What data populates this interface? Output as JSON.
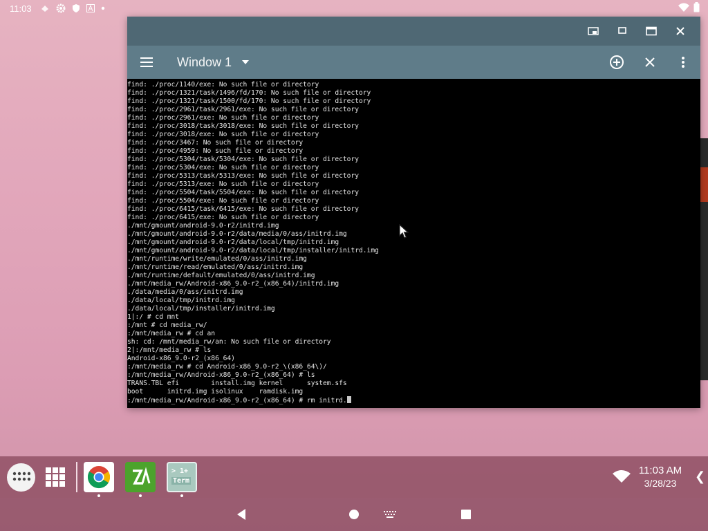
{
  "status_bar": {
    "time": "11:03",
    "icons": [
      "cloud-icon",
      "gear-icon",
      "shield-icon",
      "app-a-icon",
      "dot-icon"
    ],
    "right_icons": [
      "wifi-icon",
      "battery-icon"
    ]
  },
  "window": {
    "title_controls": [
      "picture-in-picture-icon",
      "restore-icon",
      "maximize-icon",
      "close-icon"
    ],
    "toolbar": {
      "menu_icon": "hamburger-menu-icon",
      "tab_label": "Window 1",
      "dropdown_icon": "dropdown-arrow-icon",
      "actions": [
        "add-window-icon",
        "close-window-icon",
        "more-options-icon"
      ]
    },
    "terminal": {
      "lines": [
        "find: ./proc/1140/exe: No such file or directory",
        "find: ./proc/1321/task/1496/fd/170: No such file or directory",
        "find: ./proc/1321/task/1500/fd/170: No such file or directory",
        "find: ./proc/2961/task/2961/exe: No such file or directory",
        "find: ./proc/2961/exe: No such file or directory",
        "find: ./proc/3018/task/3018/exe: No such file or directory",
        "find: ./proc/3018/exe: No such file or directory",
        "find: ./proc/3467: No such file or directory",
        "find: ./proc/4959: No such file or directory",
        "find: ./proc/5304/task/5304/exe: No such file or directory",
        "find: ./proc/5304/exe: No such file or directory",
        "find: ./proc/5313/task/5313/exe: No such file or directory",
        "find: ./proc/5313/exe: No such file or directory",
        "find: ./proc/5504/task/5504/exe: No such file or directory",
        "find: ./proc/5504/exe: No such file or directory",
        "find: ./proc/6415/task/6415/exe: No such file or directory",
        "find: ./proc/6415/exe: No such file or directory",
        "./mnt/gmount/android-9.0-r2/initrd.img",
        "./mnt/gmount/android-9.0-r2/data/media/0/ass/initrd.img",
        "./mnt/gmount/android-9.0-r2/data/local/tmp/initrd.img",
        "./mnt/gmount/android-9.0-r2/data/local/tmp/installer/initrd.img",
        "./mnt/runtime/write/emulated/0/ass/initrd.img",
        "./mnt/runtime/read/emulated/0/ass/initrd.img",
        "./mnt/runtime/default/emulated/0/ass/initrd.img",
        "./mnt/media_rw/Android-x86_9.0-r2_(x86_64)/initrd.img",
        "./data/media/0/ass/initrd.img",
        "./data/local/tmp/initrd.img",
        "./data/local/tmp/installer/initrd.img",
        "1|:/ # cd mnt",
        ":/mnt # cd media_rw/",
        ":/mnt/media_rw # cd an",
        "sh: cd: /mnt/media_rw/an: No such file or directory",
        "2|:/mnt/media_rw # ls",
        "Android-x86_9.0-r2_(x86_64)",
        ":/mnt/media_rw # cd Android-x86_9.0-r2_\\(x86_64\\)/",
        ":/mnt/media_rw/Android-x86_9.0-r2_(x86_64) # ls",
        "TRANS.TBL efi        install.img kernel      system.sfs",
        "boot      initrd.img isolinux    ramdisk.img"
      ],
      "current_prompt": ":/mnt/media_rw/Android-x86_9.0-r2_(x86_64) # rm initrd."
    }
  },
  "taskbar": {
    "all_apps_icon": "all-apps-icon",
    "grid_icon": "app-grid-icon",
    "apps": [
      {
        "name": "chrome-icon",
        "running": true
      },
      {
        "name": "zarchiver-icon",
        "running": true
      },
      {
        "name": "terminal-emulator-icon",
        "running": true
      }
    ],
    "terminal_app_label_top": "> 1+",
    "terminal_app_label_bottom": "Term",
    "tray": {
      "time": "11:03 AM",
      "date": "3/28/23",
      "chevron": "❮"
    }
  },
  "navbar": {
    "buttons": [
      "back-icon",
      "home-icon",
      "keyboard-icon",
      "recents-icon"
    ]
  }
}
